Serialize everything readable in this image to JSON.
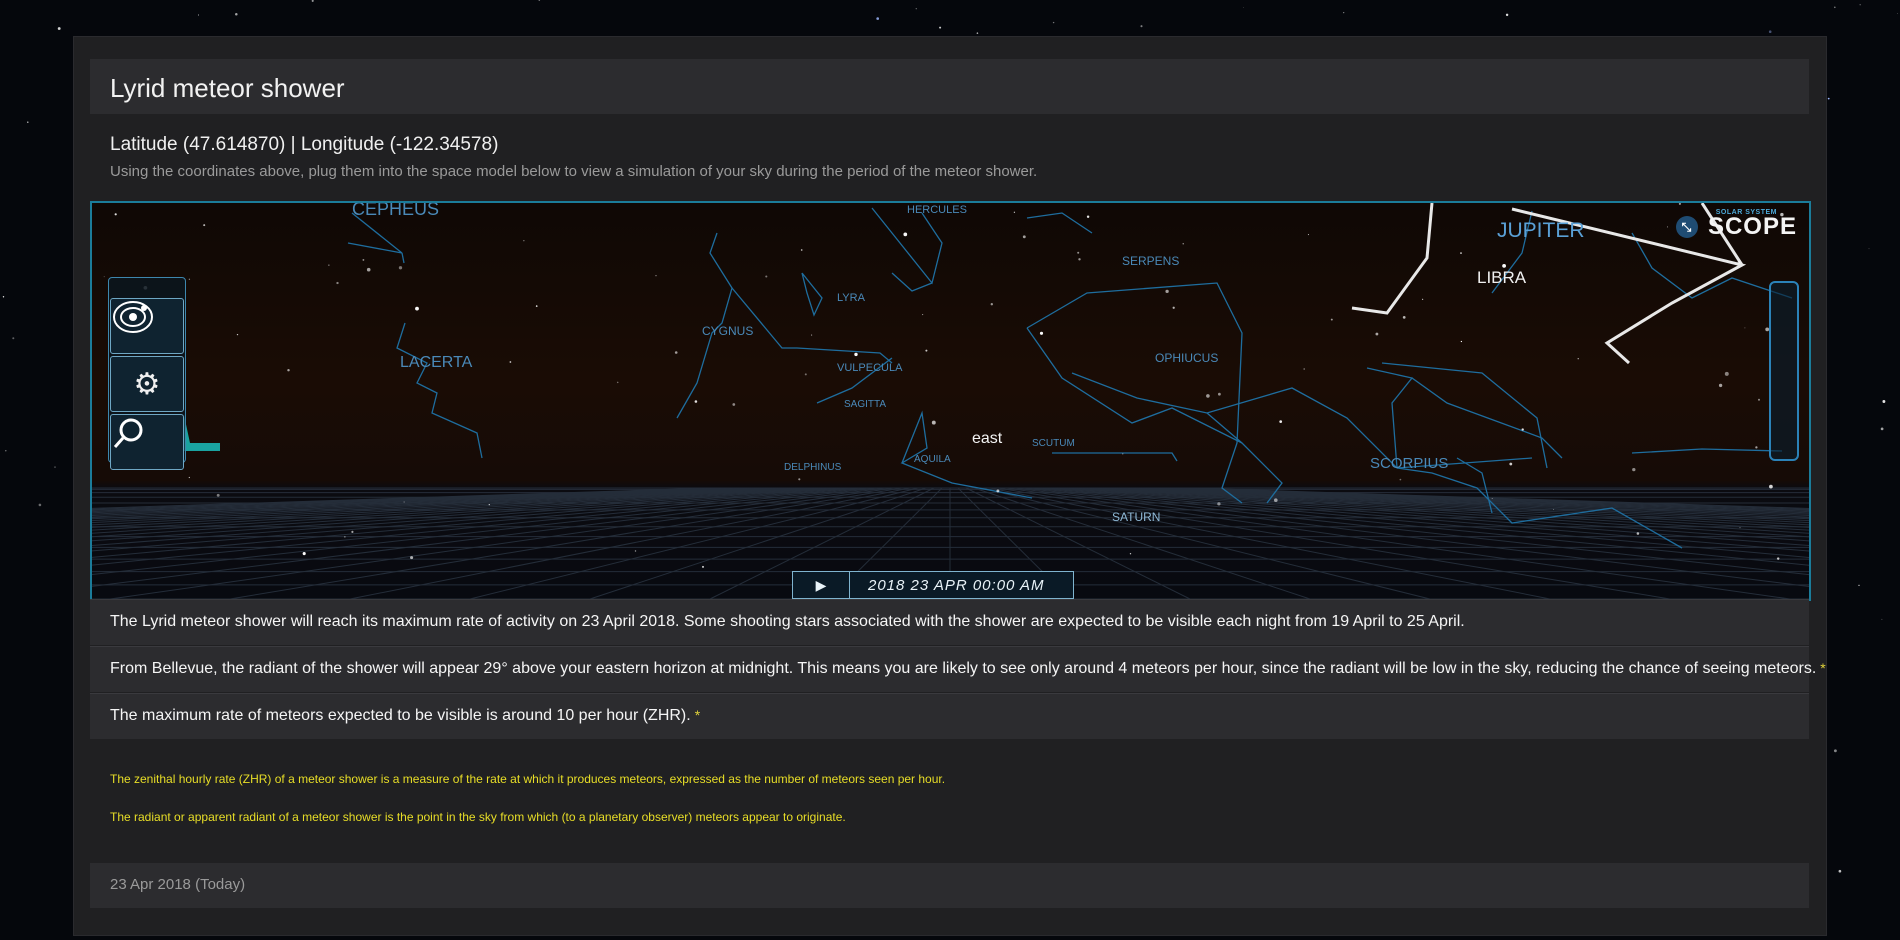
{
  "page": {
    "title": "Lyrid meteor shower",
    "coordinates": "Latitude (47.614870) | Longitude (-122.34578)",
    "hint": "Using the coordinates above, plug them into the space model below to view a simulation of your sky during the period of the meteor shower."
  },
  "sky_view": {
    "logo_small": "SOLAR SYSTEM",
    "logo": "SCOPE",
    "direction_label": "east",
    "time_label": "2018 23 APR  00:00 AM",
    "play_icon": "play-icon",
    "constellations": {
      "cepheus": "CEPHEUS",
      "hercules": "HERCULES",
      "jupiter": "JUPITER",
      "libra": "LIBRA",
      "serpens": "SERPENS",
      "lyra": "LYRA",
      "cygnus": "CYGNUS",
      "lacerta": "LACERTA",
      "vulpecula": "VULPECULA",
      "ophiucus": "OPHIUCUS",
      "sagitta": "SAGITTA",
      "scutum": "SCUTUM",
      "aquila": "AQUILA",
      "delphinus": "DELPHINUS",
      "scorpius": "SCORPIUS",
      "saturn": "SATURN"
    },
    "colors": {
      "frame": "#1b7c9a",
      "constellation_line": "#1e6d9e",
      "label": "#4a89b8"
    }
  },
  "info": {
    "row1": "The Lyrid meteor shower will reach its maximum rate of activity on 23 April 2018. Some shooting stars associated with the shower are expected to be visible each night from 19 April to 25 April.",
    "row2": "From Bellevue, the radiant of the shower will appear 29° above your eastern horizon at midnight. This means you are likely to see only around 4 meteors per hour, since the radiant will be low in the sky, reducing the chance of seeing meteors.",
    "row3": "The maximum rate of meteors expected to be visible is around 10 per hour (ZHR).",
    "star_marker": "*"
  },
  "footnotes": {
    "zhr": "The zenithal hourly rate (ZHR) of a meteor shower is a measure of the rate at which it produces meteors, expressed as the number of meteors seen per hour.",
    "radiant": "The radiant or apparent radiant of a meteor shower is the point in the sky from which (to a planetary observer) meteors appear to originate."
  },
  "date_label": "23 Apr 2018 (Today)"
}
